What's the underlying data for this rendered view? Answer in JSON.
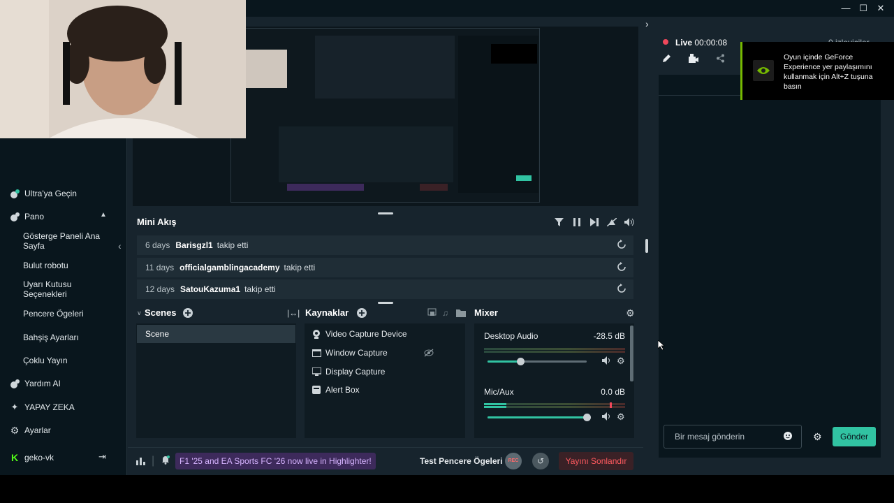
{
  "live": {
    "label": "Live",
    "time": "00:00:08",
    "viewers": "0 izleyiciler"
  },
  "sidebar": {
    "items": [
      {
        "label": "Ultra'ya Geçin",
        "icon": "ultra-icon"
      },
      {
        "label": "Pano",
        "icon": "dashboard-icon"
      },
      {
        "label": "Gösterge Paneli Ana Sayfa"
      },
      {
        "label": "Bulut robotu"
      },
      {
        "label": "Uyarı Kutusu Seçenekleri"
      },
      {
        "label": "Pencere Ögeleri"
      },
      {
        "label": "Bahşiş Ayarları"
      },
      {
        "label": "Çoklu Yayın"
      },
      {
        "label": "Yardım AI",
        "icon": "help-ai-icon"
      },
      {
        "label": "YAPAY ZEKA",
        "icon": "ai-sparkle-icon"
      },
      {
        "label": "Ayarlar",
        "icon": "gear-icon"
      }
    ],
    "user": "geko-vk"
  },
  "minifeed": {
    "title": "Mini Akış",
    "rows": [
      {
        "days": "6 days",
        "user": "Barisgzl1",
        "action": "takip etti"
      },
      {
        "days": "11 days",
        "user": "officialgamblingacademy",
        "action": "takip etti"
      },
      {
        "days": "12 days",
        "user": "SatouKazuma1",
        "action": "takip etti"
      }
    ]
  },
  "scenes": {
    "title": "Scenes",
    "items": [
      "Scene"
    ]
  },
  "sources": {
    "title": "Kaynaklar",
    "items": [
      {
        "label": "Video Capture Device",
        "icon": "webcam-icon"
      },
      {
        "label": "Window Capture",
        "icon": "window-icon"
      },
      {
        "label": "Display Capture",
        "icon": "monitor-icon"
      },
      {
        "label": "Alert Box",
        "icon": "alert-box-icon"
      }
    ]
  },
  "mixer": {
    "title": "Mixer",
    "channels": [
      {
        "name": "Desktop Audio",
        "db": "-28.5 dB",
        "volume": 0.33
      },
      {
        "name": "Mic/Aux",
        "db": "0.0 dB",
        "volume": 1.0
      }
    ]
  },
  "statusbar": {
    "highlighter": "F1 '25 and EA Sports FC '26 now live in Highlighter!",
    "test_widgets": "Test Pencere Ögeleri",
    "rec": "REC",
    "end_stream": "Yayını Sonlandır"
  },
  "chat": {
    "placeholder": "Bir mesaj gönderin",
    "send": "Gönder"
  },
  "toast": {
    "text": "Oyun içinde GeForce Experience yer paylaşımını kullanmak için Alt+Z tuşuna basın"
  },
  "colors": {
    "accent": "#31c3a2",
    "live": "#f0485b",
    "nvidia": "#76b900",
    "end_stream": "#ff5a5f"
  }
}
